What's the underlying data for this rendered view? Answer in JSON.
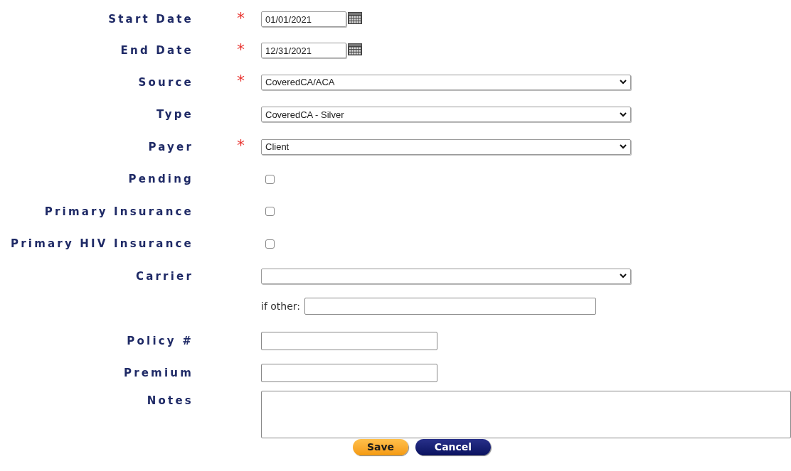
{
  "fields": [
    {
      "kind": "date",
      "label": "Start Date",
      "required_mark": "*",
      "value": "01/01/2021"
    },
    {
      "kind": "date",
      "label": "End Date",
      "required_mark": "*",
      "value": "12/31/2021"
    },
    {
      "kind": "select",
      "label": "Source",
      "required_mark": "*",
      "value": "CoveredCA/ACA"
    },
    {
      "kind": "select",
      "label": "Type",
      "value": "CoveredCA - Silver"
    },
    {
      "kind": "select",
      "label": "Payer",
      "required_mark": "*",
      "value": "Client"
    },
    {
      "kind": "checkbox",
      "label": "Pending",
      "checked": false
    },
    {
      "kind": "checkbox",
      "label": "Primary Insurance",
      "checked": false
    },
    {
      "kind": "checkbox",
      "label": "Primary HIV Insurance",
      "checked": false
    },
    {
      "kind": "select",
      "label": "Carrier"
    },
    {
      "kind": "other",
      "prefix": "if other:"
    },
    {
      "kind": "text",
      "label": "Policy #"
    },
    {
      "kind": "text",
      "label": "Premium"
    },
    {
      "kind": "textarea",
      "label": "Notes"
    }
  ],
  "buttons": [
    {
      "kind": "save",
      "label": "Save"
    },
    {
      "kind": "cancel",
      "label": "Cancel"
    }
  ]
}
